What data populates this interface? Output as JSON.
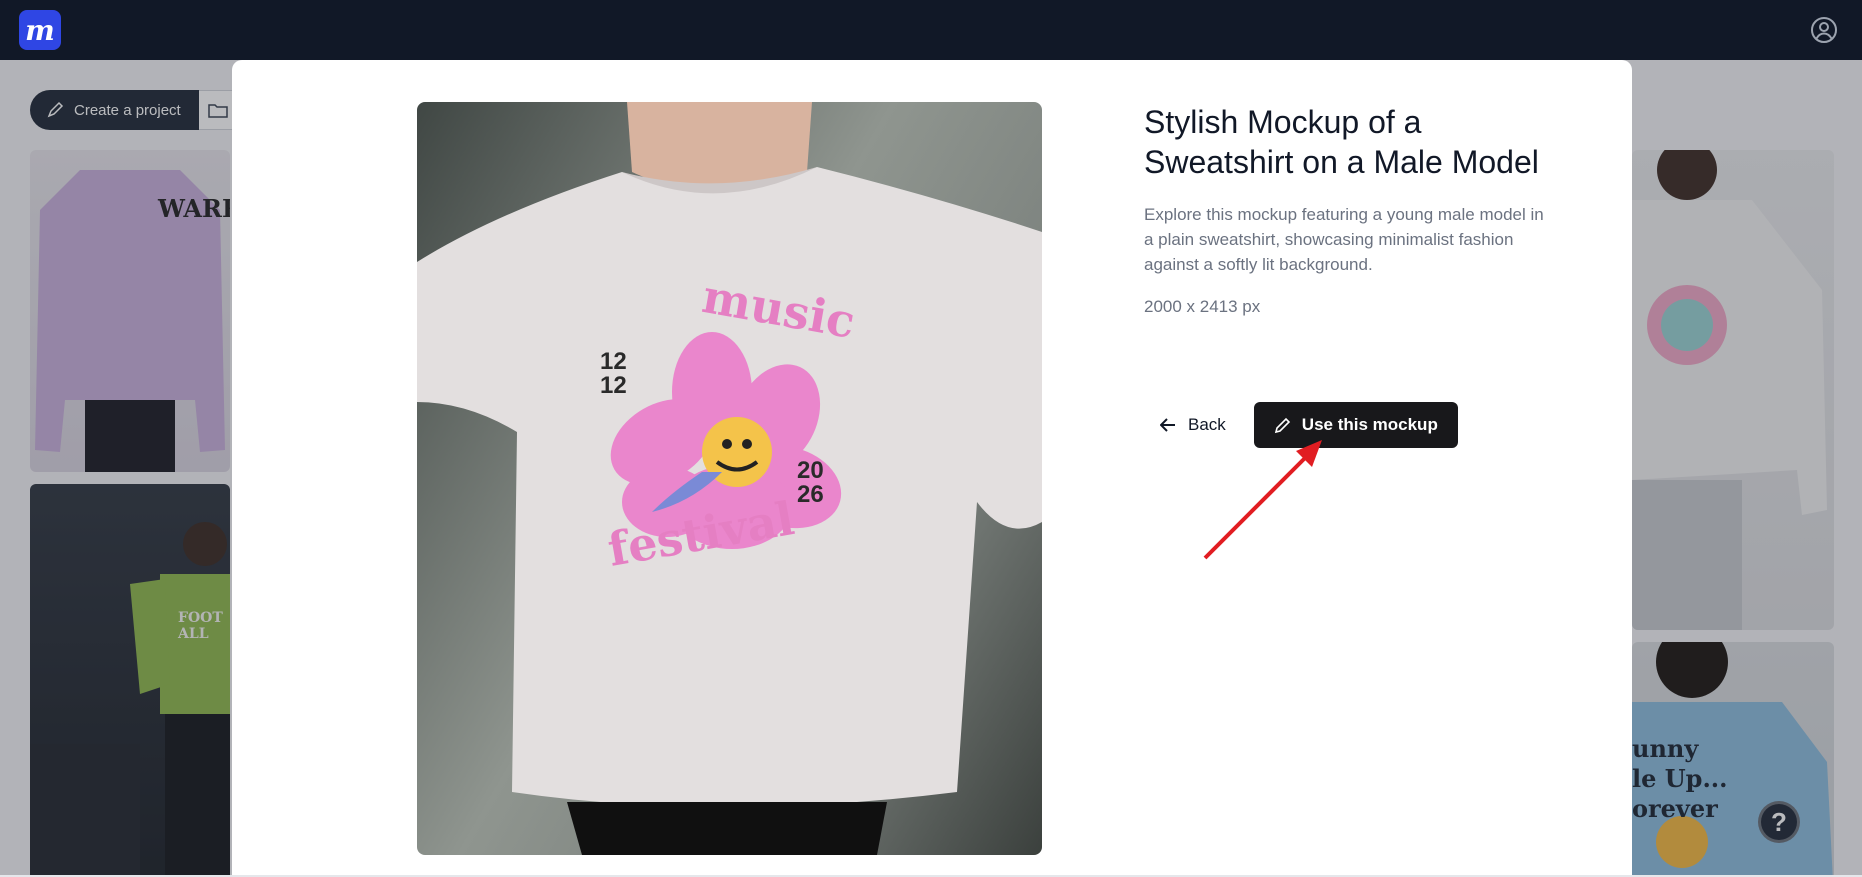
{
  "topbar": {
    "logo_text": "m",
    "logo_icon": "app-logo-icon",
    "user_icon": "user-circle-icon"
  },
  "toolbar": {
    "create_label": "Create a project",
    "create_icon": "brush-icon",
    "folder_icon": "folder-icon"
  },
  "gallery": {
    "cards": [
      {
        "text": "WARRIO",
        "color": "#d9c8e6"
      },
      {
        "text": "FOOT  ALL",
        "color": "#8fb94d"
      },
      {
        "text": "",
        "color": "#f4f4f4"
      },
      {
        "text": "unny\nle Up...\norever",
        "color": "#8cbdde"
      }
    ]
  },
  "modal": {
    "title": "Stylish Mockup of a Sweatshirt on a Male Model",
    "description": "Explore this mockup featuring a young male model in a plain sweatshirt, showcasing minimalist fashion against a softly lit background.",
    "dimensions": "2000 x 2413 px",
    "back_label": "Back",
    "use_label": "Use this mockup",
    "back_icon": "arrow-left-icon",
    "use_icon": "pencil-icon",
    "print": {
      "top_text": "music",
      "bottom_text": "festival",
      "date_left": "12 12",
      "date_right": "20 26"
    }
  },
  "help": {
    "label": "?"
  },
  "colors": {
    "topbar": "#111827",
    "primary_button": "#18181b",
    "accent_arrow": "#e11d22",
    "logo": "#2f46e4"
  }
}
